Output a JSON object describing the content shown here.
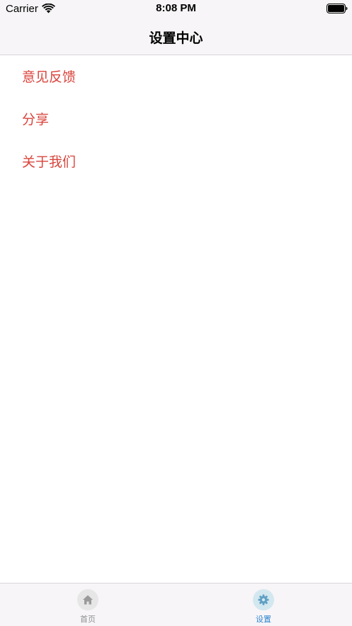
{
  "status_bar": {
    "carrier": "Carrier",
    "time": "8:08 PM"
  },
  "nav": {
    "title": "设置中心"
  },
  "menu": {
    "items": [
      {
        "label": "意见反馈"
      },
      {
        "label": "分享"
      },
      {
        "label": "关于我们"
      }
    ]
  },
  "tab_bar": {
    "tabs": [
      {
        "label": "首页",
        "icon": "home-icon",
        "selected": false
      },
      {
        "label": "设置",
        "icon": "gear-icon",
        "selected": true
      }
    ]
  },
  "colors": {
    "menu_text": "#d9443c",
    "tab_active": "#2e86d0",
    "tab_inactive": "#8e8e93",
    "bar_background": "#f7f5f7"
  }
}
